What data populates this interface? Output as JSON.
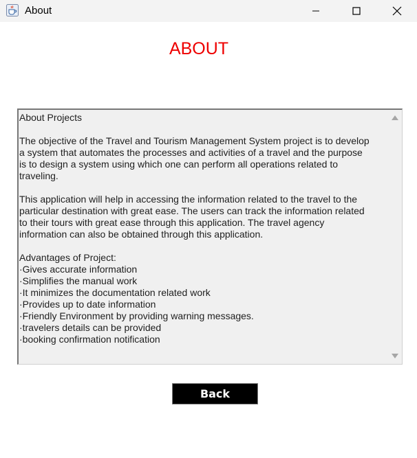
{
  "window": {
    "title": "About",
    "icon": "java-cup-icon",
    "controls": [
      "minimize-icon",
      "maximize-icon",
      "close-icon"
    ]
  },
  "heading": {
    "text": "ABOUT",
    "color": "#ee0000"
  },
  "about_text": "About Projects\n\nThe objective of the Travel and Tourism Management System project is to develop\na system that automates the processes and activities of a travel and the purpose\nis to design a system using which one can perform all operations related to\ntraveling.\n\nThis application will help in accessing the information related to the travel to the\nparticular destination with great ease. The users can track the information related\nto their tours with great ease through this application. The travel agency\ninformation can also be obtained through this application.\n\nAdvantages of Project:\n·Gives accurate information\n·Simplifies the manual work\n·It minimizes the documentation related work\n·Provides up to date information\n·Friendly Environment by providing warning messages.\n·travelers details can be provided\n·booking confirmation notification",
  "back_button": {
    "label": "Back",
    "background": "#000000",
    "color": "#ffffff"
  }
}
